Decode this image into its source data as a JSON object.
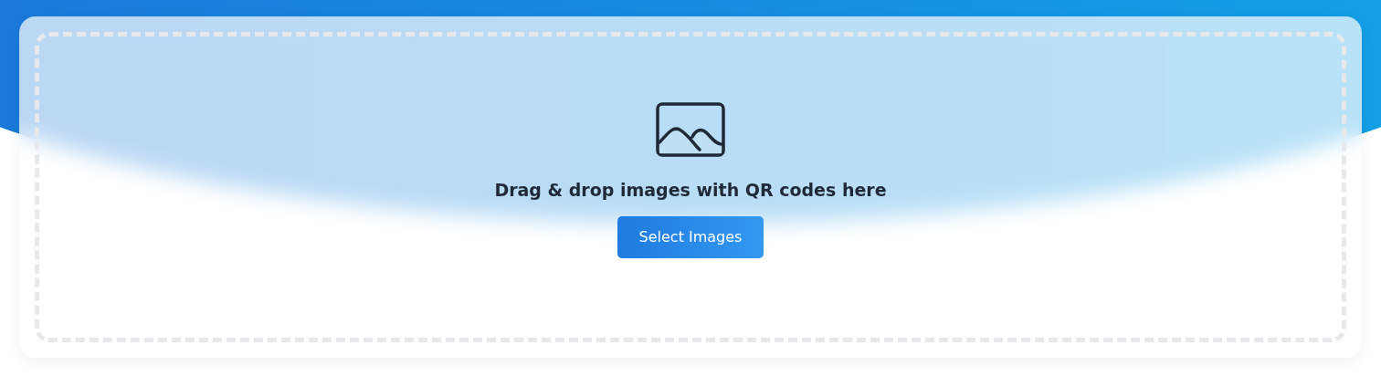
{
  "dropzone": {
    "prompt": "Drag & drop images with QR codes here",
    "button": "Select Images"
  }
}
